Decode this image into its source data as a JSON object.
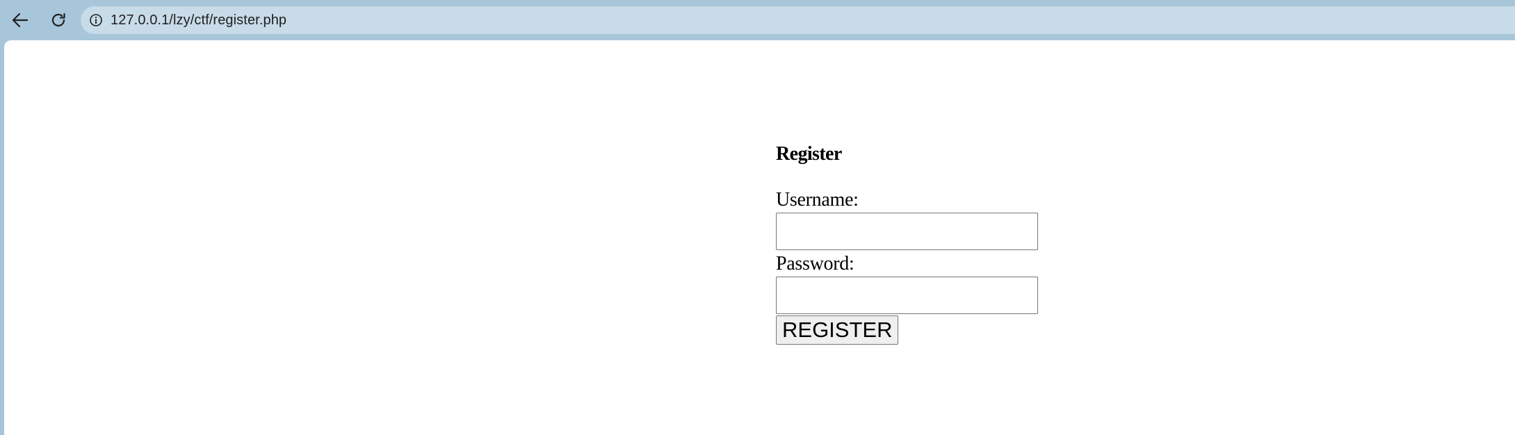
{
  "browser": {
    "url": "127.0.0.1/lzy/ctf/register.php",
    "icons": {
      "back": "arrow-left-icon",
      "reload": "reload-icon",
      "site_info": "info-circle-icon"
    }
  },
  "form": {
    "heading": "Register",
    "username_label": "Username:",
    "username_value": "",
    "password_label": "Password:",
    "password_value": "",
    "submit_label": "REGISTER"
  },
  "colors": {
    "frame": "#a7c6da",
    "address_bar": "#c8dbe8",
    "page_background": "#ffffff",
    "button_background": "#efefef",
    "input_border": "#767676"
  }
}
